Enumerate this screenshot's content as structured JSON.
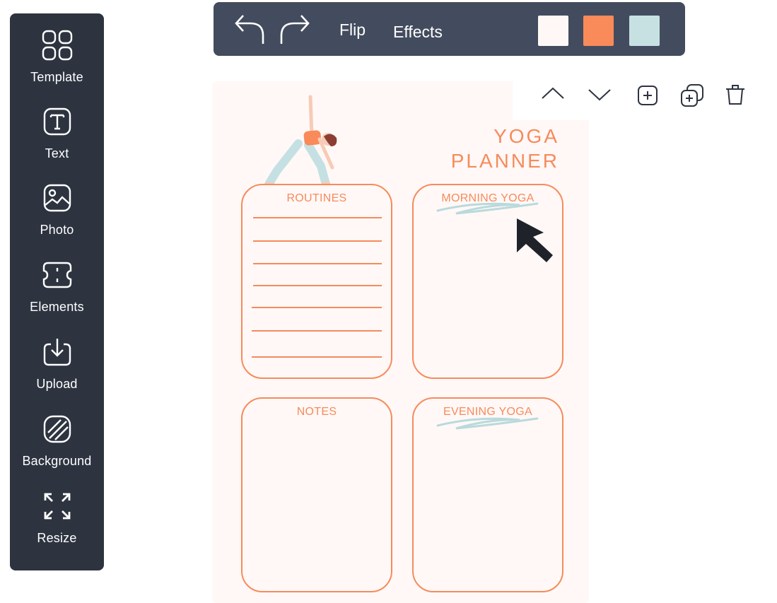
{
  "sidebar": {
    "items": [
      {
        "label": "Template",
        "icon": "grid-icon"
      },
      {
        "label": "Text",
        "icon": "text-icon"
      },
      {
        "label": "Photo",
        "icon": "photo-icon"
      },
      {
        "label": "Elements",
        "icon": "elements-icon"
      },
      {
        "label": "Upload",
        "icon": "upload-icon"
      },
      {
        "label": "Background",
        "icon": "background-icon"
      },
      {
        "label": "Resize",
        "icon": "resize-icon"
      }
    ]
  },
  "toolbar": {
    "flip_label": "Flip",
    "effects_label": "Effects",
    "swatches": [
      "#fff8f6",
      "#f98a5a",
      "#c7e1e3"
    ]
  },
  "canvas_toolbar": {
    "icons": [
      "chevron-up-icon",
      "chevron-down-icon",
      "add-page-icon",
      "duplicate-icon",
      "trash-icon"
    ]
  },
  "planner": {
    "title_line1": "YOGA",
    "title_line2": "PLANNER",
    "routines": "ROUTINES",
    "morning": "MORNING YOGA",
    "notes": "NOTES",
    "evening": "EVENING YOGA"
  },
  "colors": {
    "accent": "#f68b5c",
    "sidebar_bg": "#2d3440",
    "toolbar_bg": "#434c5e",
    "canvas_bg": "#fff8f6",
    "brush": "#b9dadc"
  }
}
